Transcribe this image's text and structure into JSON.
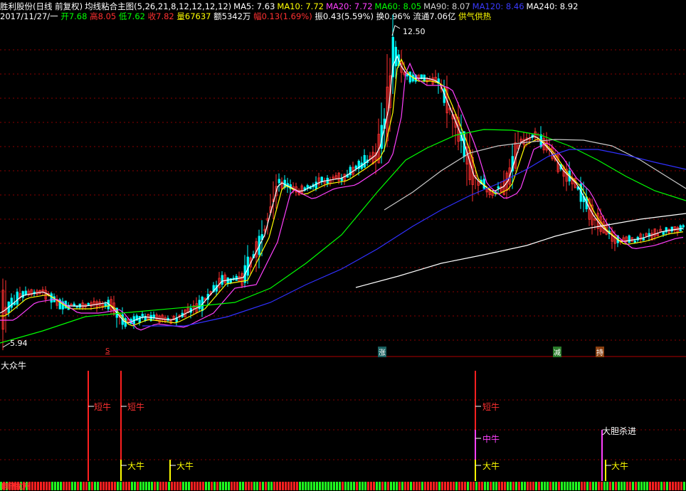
{
  "header": {
    "stock_name": "胜利股份(日线 前复权)",
    "formula_name": "均线粘合主图(5,26,21,8,12,12,12,12)",
    "ma5": "MA5: 7.63",
    "ma10": "MA10: 7.72",
    "ma20": "MA20: 7.72",
    "ma60": "MA60: 8.05",
    "ma90": "MA90: 8.07",
    "ma120": "MA120: 8.46",
    "ma240": "MA240: 8.92"
  },
  "quote": {
    "date": "2017/11/27/一",
    "open": "开7.68",
    "high": "高8.05",
    "low": "低7.62",
    "close": "收7.82",
    "volume": "量67637",
    "amount": "额5342万",
    "change": "幅0.13(1.69%)",
    "amplitude": "振0.43(5.59%)",
    "turnover": "换0.96%",
    "float_cap": "流通7.06亿",
    "supply": "供气供热"
  },
  "price_chart": {
    "high_label": "12.50",
    "low_label": "5.94",
    "signals": [
      {
        "text": "S",
        "color": "#ff3030"
      },
      {
        "text": "涨",
        "color": "#ffffff"
      },
      {
        "text": "减",
        "color": "#ffffff"
      },
      {
        "text": "持",
        "color": "#ffffff"
      }
    ]
  },
  "indicator": {
    "title": "大众牛",
    "labels": [
      "短牛",
      "短牛",
      "大牛",
      "大牛",
      "短牛",
      "中牛",
      "大牛",
      "大胆杀进",
      "大牛"
    ],
    "bottom_text": "翻倍拉升"
  },
  "colors": {
    "ma5": "#ffffff",
    "ma10": "#ffff00",
    "ma20": "#ff40ff",
    "ma60": "#00ff00",
    "ma90": "#c8c8c8",
    "ma120": "#3030ff",
    "ma240": "#ffffff",
    "up": "#ff3030",
    "down": "#00ffff",
    "grid": "#8a0000"
  }
}
